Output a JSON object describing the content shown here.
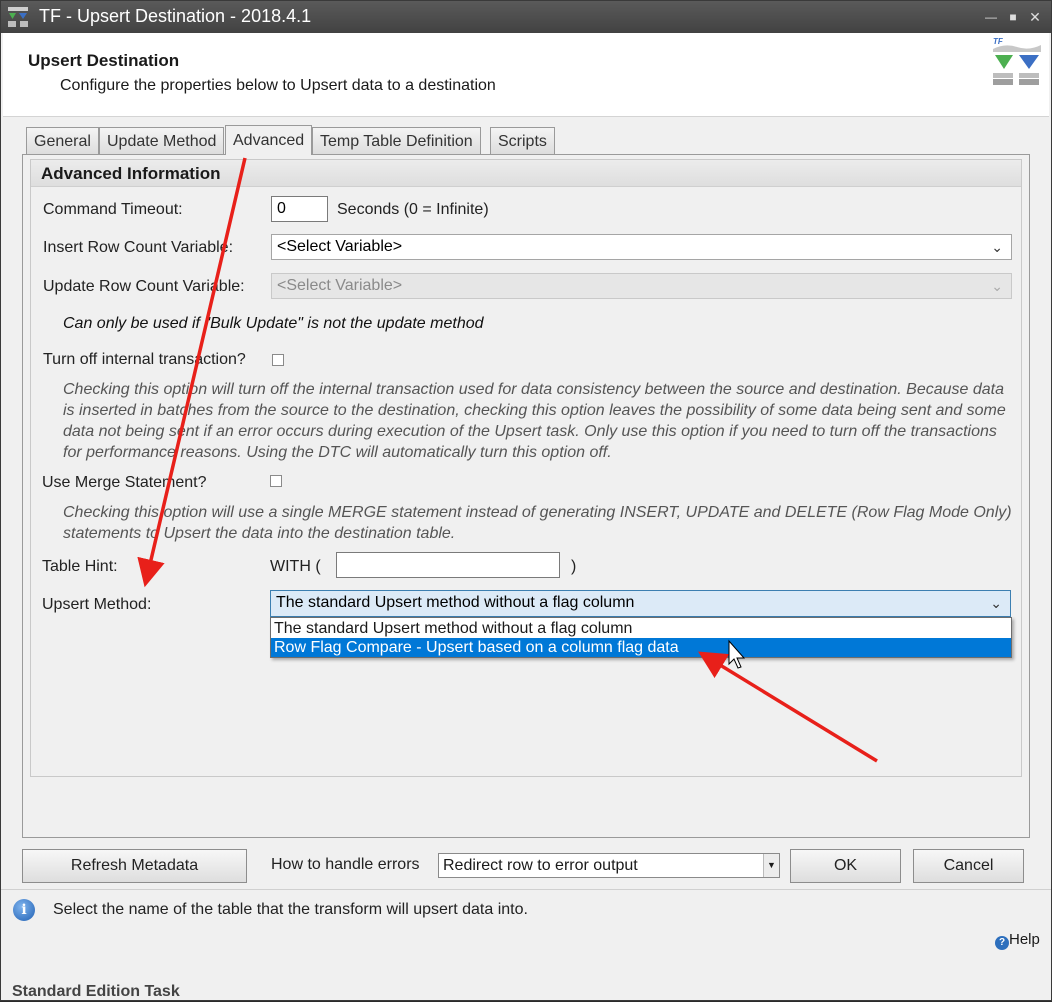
{
  "window": {
    "title": "TF - Upsert Destination - 2018.4.1",
    "controls": [
      "minimize-icon",
      "maximize-icon",
      "close-icon"
    ]
  },
  "header": {
    "title": "Upsert Destination",
    "subtitle": "Configure the properties below to Upsert data to a destination",
    "logo_text": "TF"
  },
  "tabs": [
    {
      "label": "General"
    },
    {
      "label": "Update Method"
    },
    {
      "label": "Advanced",
      "active": true
    },
    {
      "label": "Temp Table Definition"
    },
    {
      "label": "Scripts"
    }
  ],
  "advanced": {
    "section_title": "Advanced Information",
    "command_timeout": {
      "label": "Command Timeout:",
      "value": "0",
      "suffix": "Seconds (0 = Infinite)"
    },
    "insert_row_count": {
      "label": "Insert Row Count Variable:",
      "value": "<Select Variable>"
    },
    "update_row_count": {
      "label": "Update Row Count Variable:",
      "value": "<Select Variable>",
      "disabled": true
    },
    "update_note": "Can only be used if \"Bulk Update\" is not the update method",
    "internal_txn": {
      "label": "Turn off internal transaction?",
      "checked": false,
      "note": "Checking this option will turn off the internal transaction used for data consistency between the source and destination. Because data is inserted in batches from the source to the destination, checking this option leaves the possibility of some data being sent and some data not being sent if an error occurs during execution of the Upsert task. Only use this option if you need to turn off the transactions for performance reasons. Using the DTC will automatically turn this option off."
    },
    "merge": {
      "label": "Use Merge Statement?",
      "checked": false,
      "note": "Checking this option will use a single MERGE statement instead of generating INSERT, UPDATE and DELETE (Row Flag Mode Only) statements to Upsert the data into the destination table."
    },
    "table_hint": {
      "label": "Table Hint:",
      "prefix": "WITH (",
      "value": "",
      "suffix": ")"
    },
    "upsert_method": {
      "label": "Upsert Method:",
      "value": "The standard Upsert method without a flag column",
      "options": [
        "The standard Upsert method without a flag column",
        "Row Flag Compare - Upsert based on a column flag data"
      ],
      "highlighted_option": 1
    }
  },
  "bottom_bar": {
    "refresh_button": "Refresh Metadata",
    "errors_label": "How to handle errors",
    "errors_value": "Redirect row to error output",
    "ok_button": "OK",
    "cancel_button": "Cancel"
  },
  "status": {
    "message": "Select the name of the table that the transform will upsert data into.",
    "help_label": "Help",
    "edition": "Standard Edition Task"
  },
  "colors": {
    "titlebar": "#4d4d4d",
    "selection": "#0078d7",
    "annotation_arrow": "#e8201a"
  }
}
